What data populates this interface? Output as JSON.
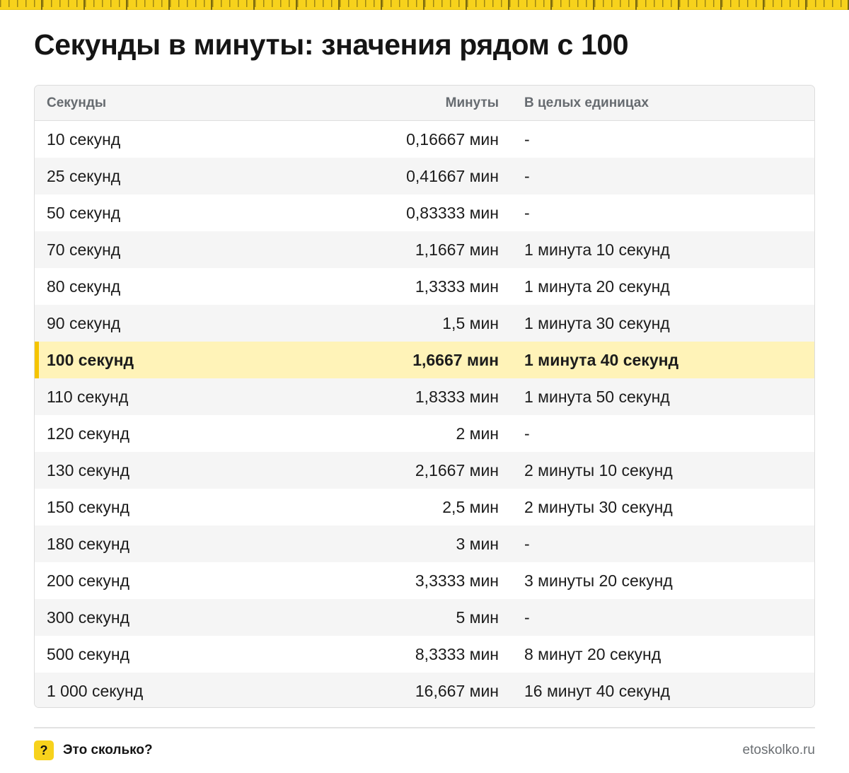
{
  "title": "Секунды в минуты: значения рядом с 100",
  "table": {
    "headers": [
      "Секунды",
      "Минуты",
      "В целых единицах"
    ],
    "rows": [
      {
        "seconds": "10 секунд",
        "minutes": "0,16667 мин",
        "whole": "-"
      },
      {
        "seconds": "25 секунд",
        "minutes": "0,41667 мин",
        "whole": "-"
      },
      {
        "seconds": "50 секунд",
        "minutes": "0,83333 мин",
        "whole": "-"
      },
      {
        "seconds": "70 секунд",
        "minutes": "1,1667 мин",
        "whole": "1 минута 10 секунд"
      },
      {
        "seconds": "80 секунд",
        "minutes": "1,3333 мин",
        "whole": "1 минута 20 секунд"
      },
      {
        "seconds": "90 секунд",
        "minutes": "1,5 мин",
        "whole": "1 минута 30 секунд"
      },
      {
        "seconds": "100 секунд",
        "minutes": "1,6667 мин",
        "whole": "1 минута 40 секунд",
        "highlighted": true
      },
      {
        "seconds": "110 секунд",
        "minutes": "1,8333 мин",
        "whole": "1 минута 50 секунд"
      },
      {
        "seconds": "120 секунд",
        "minutes": "2 мин",
        "whole": "-"
      },
      {
        "seconds": "130 секунд",
        "minutes": "2,1667 мин",
        "whole": "2 минуты 10 секунд"
      },
      {
        "seconds": "150 секунд",
        "minutes": "2,5 мин",
        "whole": "2 минуты 30 секунд"
      },
      {
        "seconds": "180 секунд",
        "minutes": "3 мин",
        "whole": "-"
      },
      {
        "seconds": "200 секунд",
        "minutes": "3,3333 мин",
        "whole": "3 минуты 20 секунд"
      },
      {
        "seconds": "300 секунд",
        "minutes": "5 мин",
        "whole": "-"
      },
      {
        "seconds": "500 секунд",
        "minutes": "8,3333 мин",
        "whole": "8 минут 20 секунд"
      },
      {
        "seconds": "1 000 секунд",
        "minutes": "16,667 мин",
        "whole": "16 минут 40 секунд"
      }
    ]
  },
  "footer": {
    "logo_glyph": "?",
    "brand": "Это сколько?",
    "site": "etoskolko.ru"
  },
  "colors": {
    "accent_yellow": "#f7d21c",
    "highlight_row": "#fff3b8",
    "highlight_bar": "#f5c400"
  }
}
